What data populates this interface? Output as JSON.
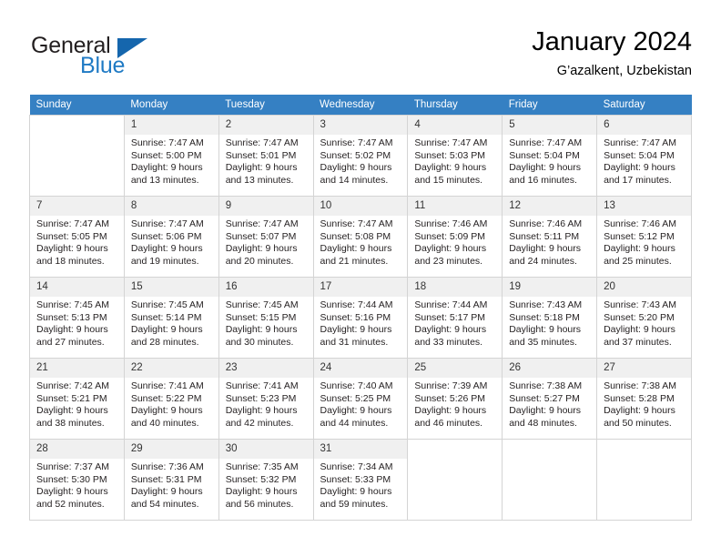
{
  "brand": {
    "name_top": "General",
    "name_bottom": "Blue",
    "triangle_icon": "triangle-icon",
    "accent_color": "#1f7ac4",
    "triangle_color": "#1566ad"
  },
  "header": {
    "title": "January 2024",
    "subtitle": "G’azalkent, Uzbekistan"
  },
  "calendar": {
    "header_color": "#3580c3",
    "weekday_headers": [
      "Sunday",
      "Monday",
      "Tuesday",
      "Wednesday",
      "Thursday",
      "Friday",
      "Saturday"
    ],
    "labels": {
      "sunrise": "Sunrise:",
      "sunset": "Sunset:",
      "daylight": "Daylight:"
    },
    "weeks": [
      [
        {
          "day": "",
          "sunrise": "",
          "sunset": "",
          "daylight_line1": "",
          "daylight_line2": ""
        },
        {
          "day": "1",
          "sunrise": "Sunrise: 7:47 AM",
          "sunset": "Sunset: 5:00 PM",
          "daylight_line1": "Daylight: 9 hours",
          "daylight_line2": "and 13 minutes."
        },
        {
          "day": "2",
          "sunrise": "Sunrise: 7:47 AM",
          "sunset": "Sunset: 5:01 PM",
          "daylight_line1": "Daylight: 9 hours",
          "daylight_line2": "and 13 minutes."
        },
        {
          "day": "3",
          "sunrise": "Sunrise: 7:47 AM",
          "sunset": "Sunset: 5:02 PM",
          "daylight_line1": "Daylight: 9 hours",
          "daylight_line2": "and 14 minutes."
        },
        {
          "day": "4",
          "sunrise": "Sunrise: 7:47 AM",
          "sunset": "Sunset: 5:03 PM",
          "daylight_line1": "Daylight: 9 hours",
          "daylight_line2": "and 15 minutes."
        },
        {
          "day": "5",
          "sunrise": "Sunrise: 7:47 AM",
          "sunset": "Sunset: 5:04 PM",
          "daylight_line1": "Daylight: 9 hours",
          "daylight_line2": "and 16 minutes."
        },
        {
          "day": "6",
          "sunrise": "Sunrise: 7:47 AM",
          "sunset": "Sunset: 5:04 PM",
          "daylight_line1": "Daylight: 9 hours",
          "daylight_line2": "and 17 minutes."
        }
      ],
      [
        {
          "day": "7",
          "sunrise": "Sunrise: 7:47 AM",
          "sunset": "Sunset: 5:05 PM",
          "daylight_line1": "Daylight: 9 hours",
          "daylight_line2": "and 18 minutes."
        },
        {
          "day": "8",
          "sunrise": "Sunrise: 7:47 AM",
          "sunset": "Sunset: 5:06 PM",
          "daylight_line1": "Daylight: 9 hours",
          "daylight_line2": "and 19 minutes."
        },
        {
          "day": "9",
          "sunrise": "Sunrise: 7:47 AM",
          "sunset": "Sunset: 5:07 PM",
          "daylight_line1": "Daylight: 9 hours",
          "daylight_line2": "and 20 minutes."
        },
        {
          "day": "10",
          "sunrise": "Sunrise: 7:47 AM",
          "sunset": "Sunset: 5:08 PM",
          "daylight_line1": "Daylight: 9 hours",
          "daylight_line2": "and 21 minutes."
        },
        {
          "day": "11",
          "sunrise": "Sunrise: 7:46 AM",
          "sunset": "Sunset: 5:09 PM",
          "daylight_line1": "Daylight: 9 hours",
          "daylight_line2": "and 23 minutes."
        },
        {
          "day": "12",
          "sunrise": "Sunrise: 7:46 AM",
          "sunset": "Sunset: 5:11 PM",
          "daylight_line1": "Daylight: 9 hours",
          "daylight_line2": "and 24 minutes."
        },
        {
          "day": "13",
          "sunrise": "Sunrise: 7:46 AM",
          "sunset": "Sunset: 5:12 PM",
          "daylight_line1": "Daylight: 9 hours",
          "daylight_line2": "and 25 minutes."
        }
      ],
      [
        {
          "day": "14",
          "sunrise": "Sunrise: 7:45 AM",
          "sunset": "Sunset: 5:13 PM",
          "daylight_line1": "Daylight: 9 hours",
          "daylight_line2": "and 27 minutes."
        },
        {
          "day": "15",
          "sunrise": "Sunrise: 7:45 AM",
          "sunset": "Sunset: 5:14 PM",
          "daylight_line1": "Daylight: 9 hours",
          "daylight_line2": "and 28 minutes."
        },
        {
          "day": "16",
          "sunrise": "Sunrise: 7:45 AM",
          "sunset": "Sunset: 5:15 PM",
          "daylight_line1": "Daylight: 9 hours",
          "daylight_line2": "and 30 minutes."
        },
        {
          "day": "17",
          "sunrise": "Sunrise: 7:44 AM",
          "sunset": "Sunset: 5:16 PM",
          "daylight_line1": "Daylight: 9 hours",
          "daylight_line2": "and 31 minutes."
        },
        {
          "day": "18",
          "sunrise": "Sunrise: 7:44 AM",
          "sunset": "Sunset: 5:17 PM",
          "daylight_line1": "Daylight: 9 hours",
          "daylight_line2": "and 33 minutes."
        },
        {
          "day": "19",
          "sunrise": "Sunrise: 7:43 AM",
          "sunset": "Sunset: 5:18 PM",
          "daylight_line1": "Daylight: 9 hours",
          "daylight_line2": "and 35 minutes."
        },
        {
          "day": "20",
          "sunrise": "Sunrise: 7:43 AM",
          "sunset": "Sunset: 5:20 PM",
          "daylight_line1": "Daylight: 9 hours",
          "daylight_line2": "and 37 minutes."
        }
      ],
      [
        {
          "day": "21",
          "sunrise": "Sunrise: 7:42 AM",
          "sunset": "Sunset: 5:21 PM",
          "daylight_line1": "Daylight: 9 hours",
          "daylight_line2": "and 38 minutes."
        },
        {
          "day": "22",
          "sunrise": "Sunrise: 7:41 AM",
          "sunset": "Sunset: 5:22 PM",
          "daylight_line1": "Daylight: 9 hours",
          "daylight_line2": "and 40 minutes."
        },
        {
          "day": "23",
          "sunrise": "Sunrise: 7:41 AM",
          "sunset": "Sunset: 5:23 PM",
          "daylight_line1": "Daylight: 9 hours",
          "daylight_line2": "and 42 minutes."
        },
        {
          "day": "24",
          "sunrise": "Sunrise: 7:40 AM",
          "sunset": "Sunset: 5:25 PM",
          "daylight_line1": "Daylight: 9 hours",
          "daylight_line2": "and 44 minutes."
        },
        {
          "day": "25",
          "sunrise": "Sunrise: 7:39 AM",
          "sunset": "Sunset: 5:26 PM",
          "daylight_line1": "Daylight: 9 hours",
          "daylight_line2": "and 46 minutes."
        },
        {
          "day": "26",
          "sunrise": "Sunrise: 7:38 AM",
          "sunset": "Sunset: 5:27 PM",
          "daylight_line1": "Daylight: 9 hours",
          "daylight_line2": "and 48 minutes."
        },
        {
          "day": "27",
          "sunrise": "Sunrise: 7:38 AM",
          "sunset": "Sunset: 5:28 PM",
          "daylight_line1": "Daylight: 9 hours",
          "daylight_line2": "and 50 minutes."
        }
      ],
      [
        {
          "day": "28",
          "sunrise": "Sunrise: 7:37 AM",
          "sunset": "Sunset: 5:30 PM",
          "daylight_line1": "Daylight: 9 hours",
          "daylight_line2": "and 52 minutes."
        },
        {
          "day": "29",
          "sunrise": "Sunrise: 7:36 AM",
          "sunset": "Sunset: 5:31 PM",
          "daylight_line1": "Daylight: 9 hours",
          "daylight_line2": "and 54 minutes."
        },
        {
          "day": "30",
          "sunrise": "Sunrise: 7:35 AM",
          "sunset": "Sunset: 5:32 PM",
          "daylight_line1": "Daylight: 9 hours",
          "daylight_line2": "and 56 minutes."
        },
        {
          "day": "31",
          "sunrise": "Sunrise: 7:34 AM",
          "sunset": "Sunset: 5:33 PM",
          "daylight_line1": "Daylight: 9 hours",
          "daylight_line2": "and 59 minutes."
        },
        {
          "day": "",
          "sunrise": "",
          "sunset": "",
          "daylight_line1": "",
          "daylight_line2": ""
        },
        {
          "day": "",
          "sunrise": "",
          "sunset": "",
          "daylight_line1": "",
          "daylight_line2": ""
        },
        {
          "day": "",
          "sunrise": "",
          "sunset": "",
          "daylight_line1": "",
          "daylight_line2": ""
        }
      ]
    ]
  }
}
